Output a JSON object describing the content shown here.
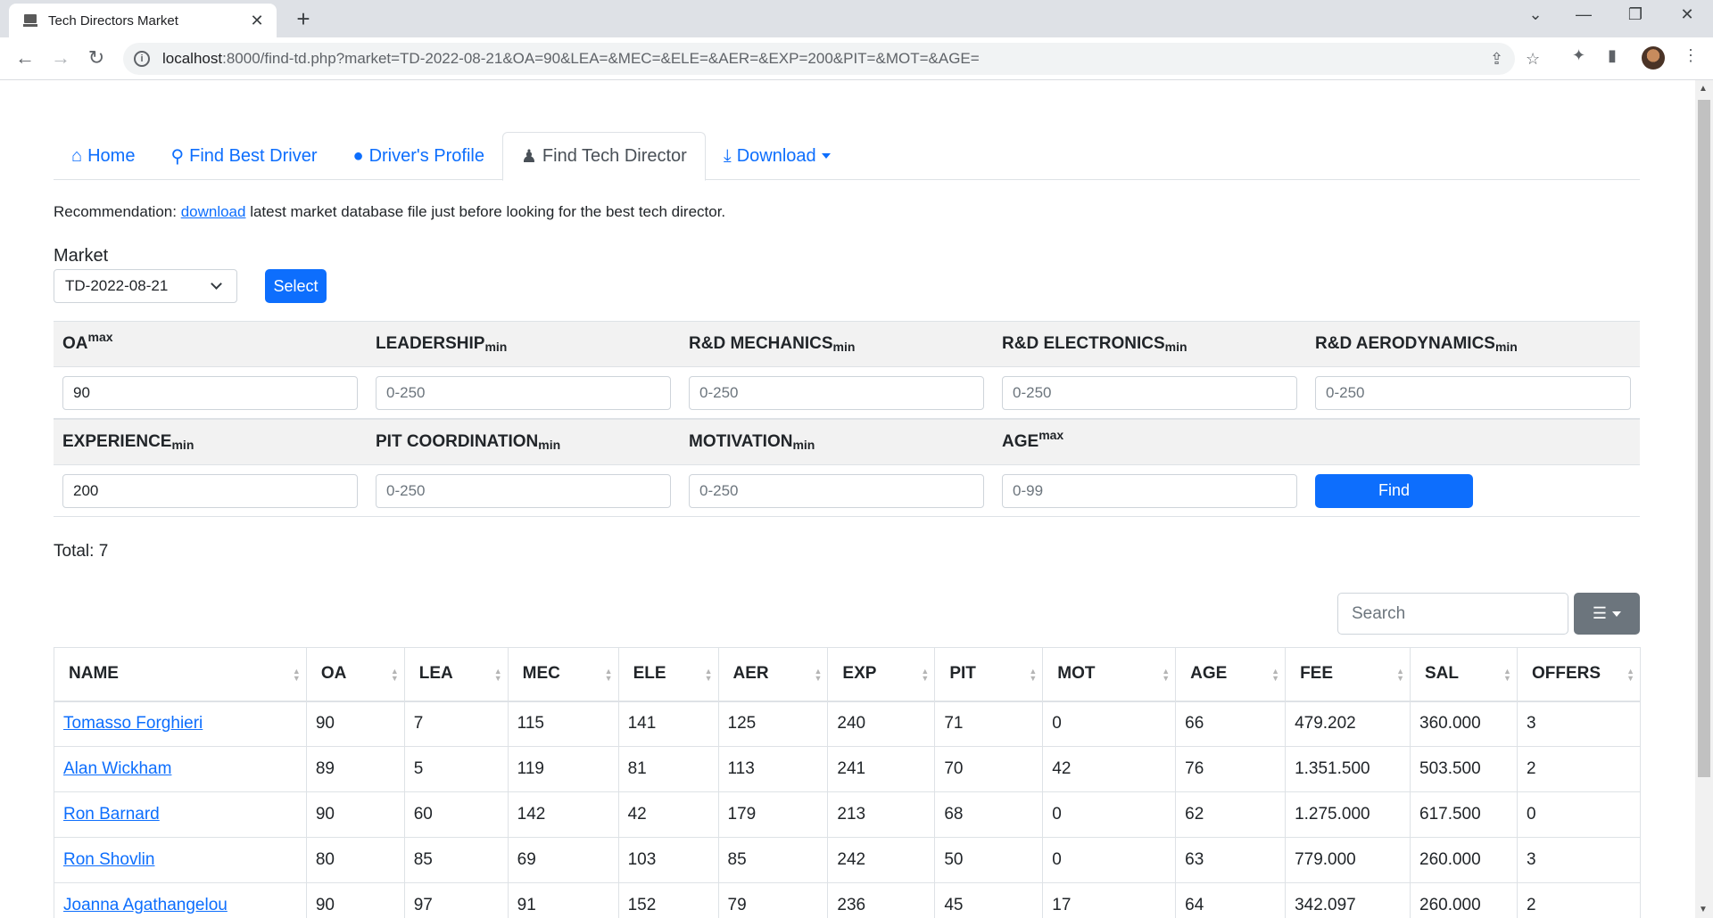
{
  "browser": {
    "tab_title": "Tech Directors Market",
    "url_host": "localhost",
    "url_path": ":8000/find-td.php?market=TD-2022-08-21&OA=90&LEA=&MEC=&ELE=&AER=&EXP=200&PIT=&MOT=&AGE="
  },
  "nav": {
    "home": "Home",
    "best_driver": "Find Best Driver",
    "profile": "Driver's Profile",
    "tech_director": "Find Tech Director",
    "download": "Download"
  },
  "recommend": {
    "prefix": "Recommendation: ",
    "link": "download",
    "suffix": " latest market database file just before looking for the best tech director."
  },
  "market": {
    "label": "Market",
    "selected": "TD-2022-08-21",
    "select_button": "Select"
  },
  "filters": {
    "oa": {
      "label": "OA",
      "mod": "max",
      "value": "90",
      "placeholder": ""
    },
    "lea": {
      "label": "LEADERSHIP",
      "mod": "min",
      "value": "",
      "placeholder": "0-250"
    },
    "mec": {
      "label": "R&D MECHANICS",
      "mod": "min",
      "value": "",
      "placeholder": "0-250"
    },
    "ele": {
      "label": "R&D ELECTRONICS",
      "mod": "min",
      "value": "",
      "placeholder": "0-250"
    },
    "aer": {
      "label": "R&D AERODYNAMICS",
      "mod": "min",
      "value": "",
      "placeholder": "0-250"
    },
    "exp": {
      "label": "EXPERIENCE",
      "mod": "min",
      "value": "200",
      "placeholder": ""
    },
    "pit": {
      "label": "PIT COORDINATION",
      "mod": "min",
      "value": "",
      "placeholder": "0-250"
    },
    "mot": {
      "label": "MOTIVATION",
      "mod": "min",
      "value": "",
      "placeholder": "0-250"
    },
    "age": {
      "label": "AGE",
      "mod": "max",
      "value": "",
      "placeholder": "0-99"
    },
    "find_button": "Find"
  },
  "total": "Total: 7",
  "search_placeholder": "Search",
  "table": {
    "headers": [
      "NAME",
      "OA",
      "LEA",
      "MEC",
      "ELE",
      "AER",
      "EXP",
      "PIT",
      "MOT",
      "AGE",
      "FEE",
      "SAL",
      "OFFERS"
    ],
    "rows": [
      [
        "Tomasso Forghieri",
        "90",
        "7",
        "115",
        "141",
        "125",
        "240",
        "71",
        "0",
        "66",
        "479.202",
        "360.000",
        "3"
      ],
      [
        "Alan Wickham",
        "89",
        "5",
        "119",
        "81",
        "113",
        "241",
        "70",
        "42",
        "76",
        "1.351.500",
        "503.500",
        "2"
      ],
      [
        "Ron Barnard",
        "90",
        "60",
        "142",
        "42",
        "179",
        "213",
        "68",
        "0",
        "62",
        "1.275.000",
        "617.500",
        "0"
      ],
      [
        "Ron Shovlin",
        "80",
        "85",
        "69",
        "103",
        "85",
        "242",
        "50",
        "0",
        "63",
        "779.000",
        "260.000",
        "3"
      ],
      [
        "Joanna Agathangelou",
        "90",
        "97",
        "91",
        "152",
        "79",
        "236",
        "45",
        "17",
        "64",
        "342.097",
        "260.000",
        "2"
      ]
    ]
  }
}
